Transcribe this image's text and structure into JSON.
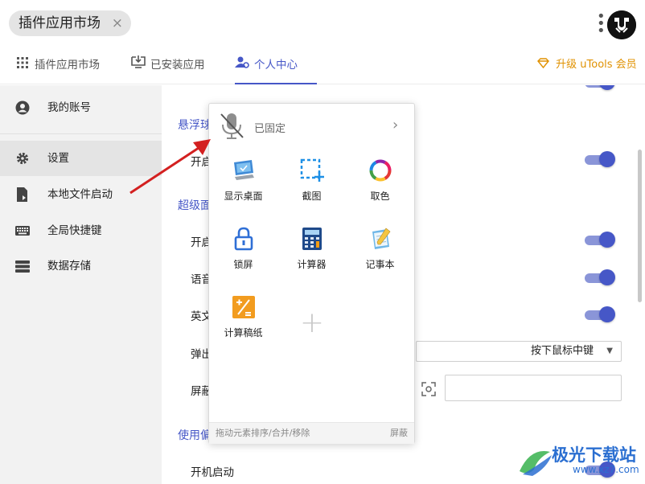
{
  "window": {
    "app_title": "插件应用市场",
    "close_glyph": "×",
    "menu_glyph": "⋮",
    "logo_glyph": "U"
  },
  "tabs": [
    {
      "label": "插件应用市场",
      "icon": "grid-icon",
      "active": false
    },
    {
      "label": "已安装应用",
      "icon": "monitor-download-icon",
      "active": false
    },
    {
      "label": "个人中心",
      "icon": "user-gear-icon",
      "active": true
    }
  ],
  "upgrade": {
    "label": "升级 uTools 会员",
    "icon": "gem-icon",
    "color": "#e09100"
  },
  "sidebar": {
    "items": [
      {
        "label": "我的账号",
        "icon": "account-icon",
        "active": false
      },
      {
        "label": "设置",
        "icon": "gear-icon",
        "active": true
      },
      {
        "label": "本地文件启动",
        "icon": "file-launch-icon",
        "active": false
      },
      {
        "label": "全局快捷键",
        "icon": "keyboard-icon",
        "active": false
      },
      {
        "label": "数据存储",
        "icon": "storage-icon",
        "active": false
      }
    ]
  },
  "settings": {
    "sections": [
      {
        "title": "悬浮球",
        "rows": [
          {
            "label": "开启",
            "toggle": true
          }
        ]
      },
      {
        "title": "超级面板",
        "rows": [
          {
            "label": "开启",
            "toggle": true
          },
          {
            "label": "语音",
            "toggle": true
          },
          {
            "label": "英文",
            "toggle": true
          },
          {
            "label": "弹出",
            "select_value": "按下鼠标中键"
          },
          {
            "label": "屏蔽",
            "input_value": ""
          }
        ]
      },
      {
        "title": "使用偏好",
        "rows": [
          {
            "label": "开机启动",
            "toggle": true
          }
        ]
      }
    ],
    "accent_color": "#4657c7"
  },
  "panel": {
    "pinned_label": "已固定",
    "chevron_glyph": "›",
    "tiles": [
      {
        "label": "显示桌面",
        "icon": "show-desktop-icon"
      },
      {
        "label": "截图",
        "icon": "screenshot-icon"
      },
      {
        "label": "取色",
        "icon": "color-picker-icon"
      },
      {
        "label": "锁屏",
        "icon": "lock-screen-icon"
      },
      {
        "label": "计算器",
        "icon": "calculator-icon"
      },
      {
        "label": "记事本",
        "icon": "notepad-icon"
      },
      {
        "label": "计算稿纸",
        "icon": "calc-paper-icon"
      }
    ],
    "add_glyph": "+",
    "footer_hint": "拖动元素排序/合并/移除",
    "footer_action": "屏蔽"
  },
  "watermark": {
    "title": "极光下载站",
    "site": "www.xz7.com"
  }
}
